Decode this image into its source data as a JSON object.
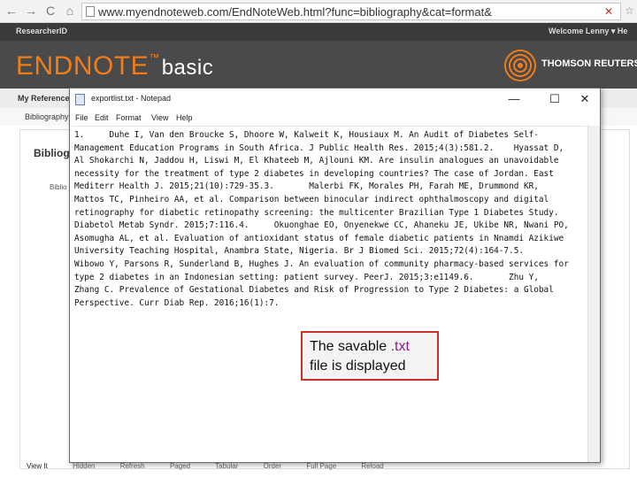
{
  "browser": {
    "url": "www.myendnoteweb.com/EndNoteWeb.html?func=bibliography&cat=format&",
    "back_glyph": "←",
    "forward_glyph": "→",
    "reload_glyph": "C",
    "home_glyph": "⌂",
    "stop_glyph": "✕",
    "icons": [
      "back-arrow-icon",
      "forward-arrow-icon",
      "reload-icon",
      "home-icon",
      "page-icon",
      "stop-icon",
      "star-icon"
    ]
  },
  "site": {
    "researcher_id": "ResearcherID",
    "welcome": "Welcome Lenny ▾   He",
    "brand": {
      "name": "ENDNOTE",
      "tm": "™",
      "edition": "basic"
    },
    "publisher": "THOMSON REUTERS",
    "refs_label": "My References",
    "sub_label": "Bibliography",
    "page_heading": "Bibliogr",
    "sub_heading": "Biblio",
    "bottom_tabs": [
      "View It",
      "Hidden",
      "Refresh",
      "Paged",
      "Tabular",
      "Order",
      "Full Page",
      "Reload"
    ],
    "colors": {
      "brand_orange": "#f07c1a",
      "header_dark": "#4a4a4a"
    }
  },
  "notepad": {
    "title": "exportlist.txt - Notepad",
    "menu": [
      "File",
      "Edit",
      "Format",
      "View",
      "Help"
    ],
    "controls": {
      "minimize": "—",
      "maximize": "☐",
      "close": "✕"
    },
    "lines": [
      "1.     Duhe I, Van den Broucke S, Dhoore W, Kalweit K, Housiaux M. An Audit of Diabetes Self-",
      "Management Education Programs in South Africa. J Public Health Res. 2015;4(3):581.2.    Hyassat D,",
      "Al Shokarchi N, Jaddou H, Liswi M, El Khateeb M, Ajlouni KM. Are insulin analogues an unavoidable",
      "necessity for the treatment of type 2 diabetes in developing countries? The case of Jordan. East",
      "Mediterr Health J. 2015;21(10):729-35.3.       Malerbi FK, Morales PH, Farah ME, Drummond KR,",
      "Mattos TC, Pinheiro AA, et al. Comparison between binocular indirect ophthalmoscopy and digital",
      "retinography for diabetic retinopathy screening: the multicenter Brazilian Type 1 Diabetes Study.",
      "Diabetol Metab Syndr. 2015;7:116.4.     Okuonghae EO, Onyenekwe CC, Ahaneku JE, Ukibe NR, Nwani PO,",
      "Asomugha AL, et al. Evaluation of antioxidant status of female diabetic patients in Nnamdi Azikiwe",
      "University Teaching Hospital, Anambra State, Nigeria. Br J Biomed Sci. 2015;72(4):164-7.5.",
      "Wibowo Y, Parsons R, Sunderland B, Hughes J. An evaluation of community pharmacy-based services for",
      "type 2 diabetes in an Indonesian setting: patient survey. PeerJ. 2015;3:e1149.6.       Zhu Y,",
      "Zhang C. Prevalence of Gestational Diabetes and Risk of Progression to Type 2 Diabetes: a Global",
      "Perspective. Curr Diab Rep. 2016;16(1):7."
    ]
  },
  "callout": {
    "text_before": "The savable ",
    "ext": ".txt",
    "text_after": "file is displayed",
    "border_color": "#cc2f2f"
  }
}
